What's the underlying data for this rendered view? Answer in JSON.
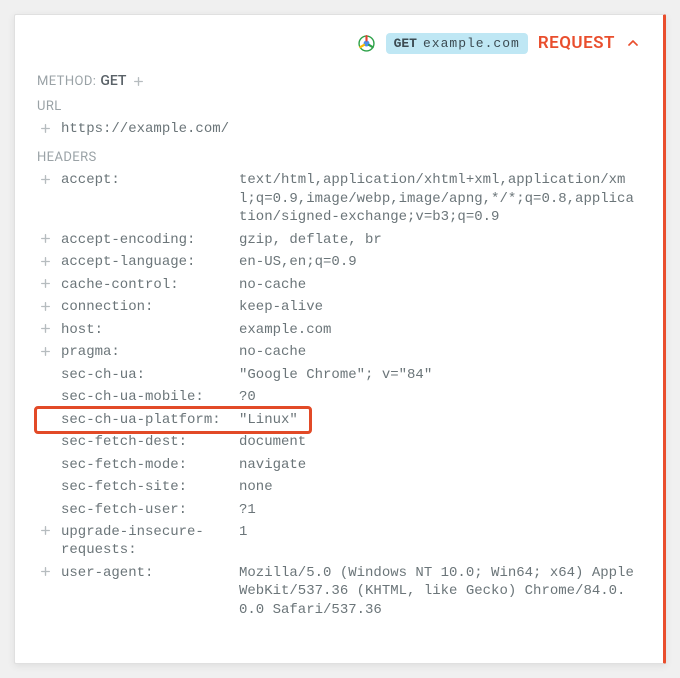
{
  "topbar": {
    "badge_method": "GET",
    "badge_domain": "example.com",
    "title": "REQUEST"
  },
  "method": {
    "label": "METHOD:",
    "value": "GET"
  },
  "url": {
    "label": "URL",
    "value": "https://example.com/"
  },
  "headers_label": "HEADERS",
  "headers": [
    {
      "name": "accept:",
      "value": "text/html,application/xhtml+xml,application/xml;q=0.9,image/webp,image/apng,*/*;q=0.8,application/signed-exchange;v=b3;q=0.9",
      "addable": true
    },
    {
      "name": "accept-encoding:",
      "value": "gzip, deflate, br",
      "addable": true
    },
    {
      "name": "accept-language:",
      "value": "en-US,en;q=0.9",
      "addable": true
    },
    {
      "name": "cache-control:",
      "value": "no-cache",
      "addable": true
    },
    {
      "name": "connection:",
      "value": "keep-alive",
      "addable": true
    },
    {
      "name": "host:",
      "value": "example.com",
      "addable": true
    },
    {
      "name": "pragma:",
      "value": "no-cache",
      "addable": true
    },
    {
      "name": "sec-ch-ua:",
      "value": "\"Google Chrome\"; v=\"84\"",
      "addable": false
    },
    {
      "name": "sec-ch-ua-mobile:",
      "value": "?0",
      "addable": false
    },
    {
      "name": "sec-ch-ua-platform:",
      "value": "\"Linux\"",
      "addable": false
    },
    {
      "name": "sec-fetch-dest:",
      "value": "document",
      "addable": false
    },
    {
      "name": "sec-fetch-mode:",
      "value": "navigate",
      "addable": false
    },
    {
      "name": "sec-fetch-site:",
      "value": "none",
      "addable": false
    },
    {
      "name": "sec-fetch-user:",
      "value": "?1",
      "addable": false
    },
    {
      "name": "upgrade-insecure-requests:",
      "value": "1",
      "addable": true
    },
    {
      "name": "user-agent:",
      "value": "Mozilla/5.0 (Windows NT 10.0; Win64; x64) AppleWebKit/537.36 (KHTML, like Gecko) Chrome/84.0.0.0 Safari/537.36",
      "addable": true
    }
  ],
  "highlight_index": 9,
  "colors": {
    "accent": "#e94e2d",
    "badge_bg": "#bfe7f4"
  }
}
